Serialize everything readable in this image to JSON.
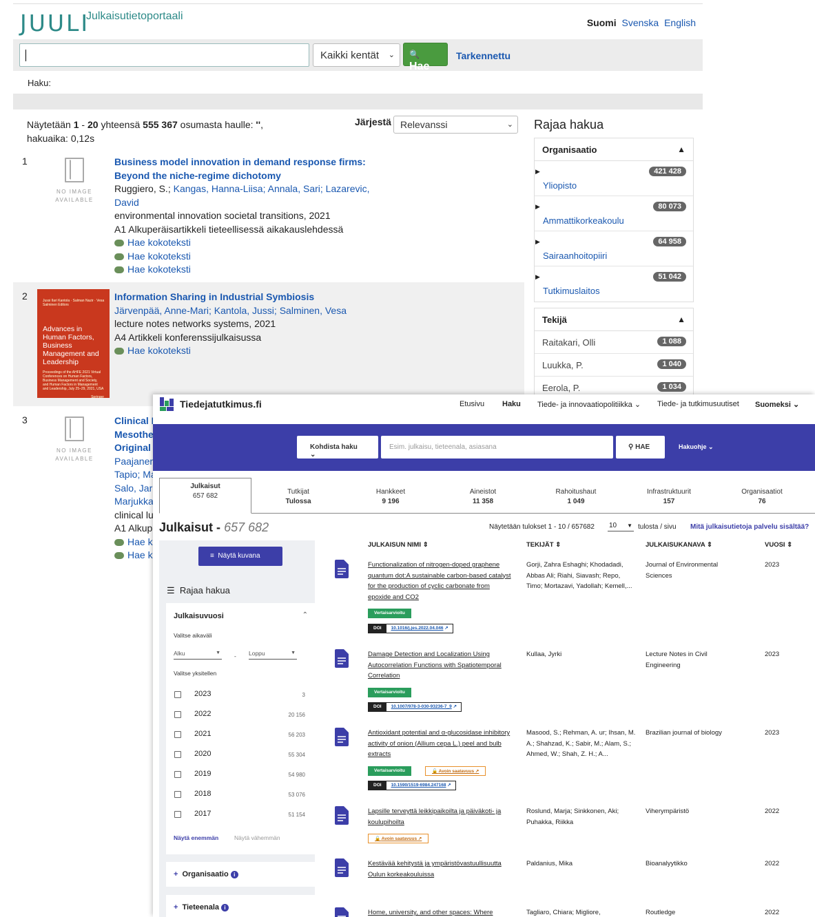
{
  "juuli": {
    "logo": "JUULI",
    "portal": "Julkaisutietoportaali",
    "languages": {
      "current": "Suomi",
      "other": [
        "Svenska",
        "English"
      ]
    },
    "search": {
      "field_select": "Kaikki kentät",
      "button": "Hae",
      "advanced": "Tarkennettu",
      "value": ""
    },
    "breadcrumb": "Haku:",
    "summary": {
      "prefix": "Näytetään",
      "range": "1",
      "range_sep": "-",
      "range_end": "20",
      "mid": "yhteensä",
      "total": "555 367",
      "suffix": "osumasta haulle:",
      "query": "''",
      "time": "hakuaika: 0,12s"
    },
    "sort": {
      "label": "Järjestä",
      "value": "Relevanssi"
    },
    "no_image": [
      "NO IMAGE",
      "AVAILABLE"
    ],
    "records": [
      {
        "num": "1",
        "title": "Business model innovation in demand response firms: Beyond the niche-regime dichotomy",
        "author_first": "Ruggiero, S.;",
        "authors_links": [
          "Kangas, Hanna-Liisa;",
          "Annala, Sari;",
          "Lazarevic, David"
        ],
        "source": "environmental innovation societal transitions, 2021",
        "type": "A1 Alkuperäisartikkeli tieteellisessä aikakauslehdessä",
        "fulltext": [
          "Hae kokoteksti",
          "Hae kokoteksti",
          "Hae kokoteksti"
        ]
      },
      {
        "num": "2",
        "title": "Information Sharing in Industrial Symbiosis",
        "authors_links": [
          "Järvenpää, Anne-Mari;",
          "Kantola, Jussi;",
          "Salminen, Vesa"
        ],
        "source": "lecture notes networks systems, 2021",
        "type": "A4 Artikkeli konferenssijulkaisussa",
        "fulltext": [
          "Hae kokoteksti"
        ],
        "cover": {
          "title": "Advances in Human Factors, Business Management and Leadership",
          "small": "Jussi Ilari Kantola · Salman Nazir · Vesa Salminen Editors",
          "sub": "Proceedings of the AHFE 2021 Virtual Conferences on Human Factors, Business Management and Society, and Human Factors in Management and Leadership, July 25–29, 2021, USA",
          "publisher": "Springer"
        }
      },
      {
        "num": "3",
        "title_lines": [
          "Clinical I",
          "Mesothe",
          "Original"
        ],
        "author_lines": [
          "Paajaner",
          "Tapio; Ma",
          "Salo, Jari",
          "Marjukka"
        ],
        "source": "clinical lu",
        "type": "A1 Alkup",
        "fulltext": [
          "Hae k",
          "Hae k"
        ]
      }
    ],
    "facets": {
      "heading": "Rajaa hakua",
      "organisaatio": {
        "title": "Organisaatio",
        "items": [
          {
            "name": "Yliopisto",
            "count": "421 428"
          },
          {
            "name": "Ammattikorkeakoulu",
            "count": "80 073"
          },
          {
            "name": "Sairaanhoitopiiri",
            "count": "64 958"
          },
          {
            "name": "Tutkimuslaitos",
            "count": "51 042"
          }
        ]
      },
      "tekija": {
        "title": "Tekijä",
        "items": [
          {
            "name": "Raitakari, Olli",
            "count": "1 088"
          },
          {
            "name": "Luukka, P.",
            "count": "1 040"
          },
          {
            "name": "Eerola, P.",
            "count": "1 034"
          }
        ]
      }
    }
  },
  "tt": {
    "brand": "Tiedejatutkimus.fi",
    "nav": [
      "Etusivu",
      "Haku",
      "Tiede- ja innovaatiopolitiikka",
      "Tiede- ja tutkimusuutiset",
      "Suomeksi"
    ],
    "search": {
      "scope": "Kohdista haku",
      "placeholder": "Esim. julkaisu, tieteenala, asiasana",
      "button": "HAE",
      "help": "Hakuohje"
    },
    "tabs": [
      {
        "label": "Julkaisut",
        "count": "657 682"
      },
      {
        "label": "Tutkijat",
        "count": "Tulossa"
      },
      {
        "label": "Hankkeet",
        "count": "9 196"
      },
      {
        "label": "Aineistot",
        "count": "11 358"
      },
      {
        "label": "Rahoitushaut",
        "count": "1 049"
      },
      {
        "label": "Infrastruktuurit",
        "count": "157"
      },
      {
        "label": "Organisaatiot",
        "count": "76"
      }
    ],
    "heading": "Julkaisut",
    "heading_sep": "-",
    "heading_count": "657 682",
    "shown": "Näytetään tulokset 1 - 10 / 657682",
    "per_page": "10",
    "per_page_label": "tulosta / sivu",
    "what": "Mitä julkaisutietoja palvelu sisältää?",
    "sidebar": {
      "show_chart": "Näytä kuvana",
      "refine": "Rajaa hakua",
      "year_box": {
        "title": "Julkaisuvuosi",
        "range_label": "Valitse aikaväli",
        "start": "Alku",
        "dash": "-",
        "end": "Loppu",
        "single_label": "Valitse yksitellen",
        "years": [
          {
            "year": "2023",
            "count": "3"
          },
          {
            "year": "2022",
            "count": "20 156"
          },
          {
            "year": "2021",
            "count": "56 203"
          },
          {
            "year": "2020",
            "count": "55 304"
          },
          {
            "year": "2019",
            "count": "54 980"
          },
          {
            "year": "2018",
            "count": "53 076"
          },
          {
            "year": "2017",
            "count": "51 154"
          }
        ],
        "more": "Näytä enemmän",
        "less": "Näytä vähemmän"
      },
      "organisaatio": "Organisaatio",
      "tieteenala": "Tieteenala"
    },
    "columns": [
      "JULKAISUN NIMI",
      "TEKIJÄT",
      "JULKAISUKANAVA",
      "VUOSI"
    ],
    "badges": {
      "vert": "Vertaisarvioitu",
      "avoin": "Avoin saatavuus",
      "doi": "DOI"
    },
    "rows": [
      {
        "title": "Functionalization of nitrogen-doped graphene quantum dot:A sustainable carbon-based catalyst for the production of cyclic carbonate from epoxide and CO2",
        "authors": "Gorji, Zahra Eshaghi; Khodadadi, Abbas Ali; Riahi, Siavash; Repo, Timo; Mortazavi, Yadollah; Kemell,...",
        "channel": "Journal of Environmental Sciences",
        "year": "2023",
        "doi": "10.1016/j.jes.2022.04.046"
      },
      {
        "title": "Damage Detection and Localization Using Autocorrelation Functions with Spatiotemporal Correlation",
        "authors": "Kullaa, Jyrki",
        "channel": "Lecture Notes in Civil Engineering",
        "year": "2023",
        "doi": "10.1007/978-3-030-93236-7_9"
      },
      {
        "title": "Antioxidant potential and α-glucosidase inhibitory activity of onion (Allium cepa L.) peel and bulb extracts",
        "authors": "Masood, S.; Rehman, A. ur; Ihsan, M. A.; Shahzad, K.; Sabir, M.; Alam, S.; Ahmed, W.; Shah, Z. H.; A...",
        "channel": "Brazilian journal of biology",
        "year": "2023",
        "doi": "10.1590/1519-6984.247168"
      },
      {
        "title": "Lapsille terveyttä leikkipaikoilta ja päiväkoti- ja koulupihoilta",
        "authors": "Roslund, Marja; Sinkkonen, Aki; Puhakka, Riikka",
        "channel": "Viherympäristö",
        "year": "2022"
      },
      {
        "title": "Kestävää kehitystä ja ympäristövastuullisuutta Oulun korkeakouluissa",
        "authors": "Paldanius, Mika",
        "channel": "Bioanalyytikko",
        "year": "2022"
      },
      {
        "title": "Home, university, and other spaces: Where",
        "authors": "Tagliaro, Chiara; Migliore,",
        "channel": "Routledge",
        "year": "2022"
      }
    ]
  },
  "colors": {
    "juuli_teal": "#2d8a88",
    "link": "#1a58b0",
    "hae_green": "#4a9b3f",
    "tt_indigo": "#3c3ea8",
    "vert_green": "#2a9d5c",
    "avoin_orange": "#e8902a"
  }
}
